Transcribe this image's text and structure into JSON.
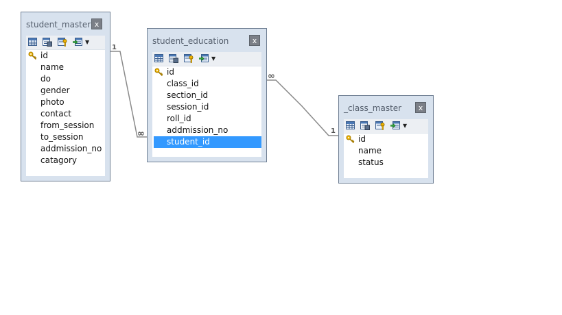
{
  "tables": [
    {
      "id": "student_master",
      "title": "student_master",
      "close_label": "x",
      "fields": [
        {
          "name": "id",
          "primary_key": true
        },
        {
          "name": "name",
          "primary_key": false
        },
        {
          "name": "do",
          "primary_key": false
        },
        {
          "name": "gender",
          "primary_key": false
        },
        {
          "name": "photo",
          "primary_key": false
        },
        {
          "name": "contact",
          "primary_key": false
        },
        {
          "name": "from_session",
          "primary_key": false
        },
        {
          "name": "to_session",
          "primary_key": false
        },
        {
          "name": "addmission_no",
          "primary_key": false
        },
        {
          "name": "catagory",
          "primary_key": false
        }
      ],
      "selected_field": null
    },
    {
      "id": "student_education",
      "title": "student_education",
      "close_label": "x",
      "fields": [
        {
          "name": "id",
          "primary_key": true
        },
        {
          "name": "class_id",
          "primary_key": false
        },
        {
          "name": "section_id",
          "primary_key": false
        },
        {
          "name": "session_id",
          "primary_key": false
        },
        {
          "name": "roll_id",
          "primary_key": false
        },
        {
          "name": "addmission_no",
          "primary_key": false
        },
        {
          "name": "student_id",
          "primary_key": false
        }
      ],
      "selected_field": "student_id"
    },
    {
      "id": "class_master",
      "title": "_class_master",
      "close_label": "x",
      "fields": [
        {
          "name": "id",
          "primary_key": true
        },
        {
          "name": "name",
          "primary_key": false
        },
        {
          "name": "status",
          "primary_key": false
        }
      ],
      "selected_field": null
    }
  ],
  "relationships": [
    {
      "from": "student_master",
      "to": "student_education",
      "from_cardinality": "1",
      "to_cardinality": "∞"
    },
    {
      "from": "class_master",
      "to": "student_education",
      "from_cardinality": "1",
      "to_cardinality": "∞"
    }
  ],
  "toolbar_icons": [
    "table-grid-icon",
    "table-properties-icon",
    "table-key-icon",
    "add-field-icon",
    "dropdown-arrow-icon"
  ],
  "colors": {
    "frame": "#d8e2ee",
    "border": "#6f7f93",
    "selection": "#3399ff",
    "line": "#8a8a8a"
  }
}
